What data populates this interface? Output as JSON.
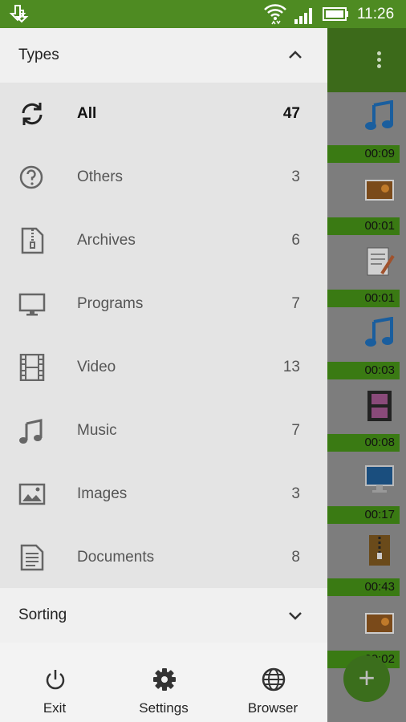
{
  "status_bar": {
    "time": "11:26",
    "icons": [
      "download-icon",
      "wifi-icon",
      "signal-icon",
      "battery-icon"
    ]
  },
  "drawer": {
    "types_header": {
      "title": "Types",
      "icon": "chevron-up-icon"
    },
    "types": [
      {
        "label": "All",
        "count": "47",
        "icon": "refresh-icon",
        "active": true
      },
      {
        "label": "Others",
        "count": "3",
        "icon": "question-icon"
      },
      {
        "label": "Archives",
        "count": "6",
        "icon": "archive-icon"
      },
      {
        "label": "Programs",
        "count": "7",
        "icon": "monitor-icon"
      },
      {
        "label": "Video",
        "count": "13",
        "icon": "film-icon"
      },
      {
        "label": "Music",
        "count": "7",
        "icon": "music-icon"
      },
      {
        "label": "Images",
        "count": "3",
        "icon": "image-icon"
      },
      {
        "label": "Documents",
        "count": "8",
        "icon": "document-icon"
      }
    ],
    "sorting_header": {
      "title": "Sorting",
      "icon": "chevron-down-icon"
    },
    "footer": [
      {
        "label": "Exit",
        "icon": "power-icon"
      },
      {
        "label": "Settings",
        "icon": "gear-icon"
      },
      {
        "label": "Browser",
        "icon": "globe-icon"
      }
    ]
  },
  "background_list": {
    "durations": [
      "00:09",
      "00:01",
      "00:01",
      "00:03",
      "00:08",
      "00:17",
      "00:43",
      "00:02"
    ],
    "thumb_icons": [
      "music-note-icon",
      "photo-thumb-icon",
      "document-edit-icon",
      "music-note-icon",
      "video-thumb-icon",
      "monitor-thumb-icon",
      "archive-thumb-icon",
      "photo-thumb-icon"
    ]
  },
  "colors": {
    "accent": "#4e8b22",
    "drawer_bg": "#f3f3f3",
    "list_bg": "#e4e4e4"
  }
}
